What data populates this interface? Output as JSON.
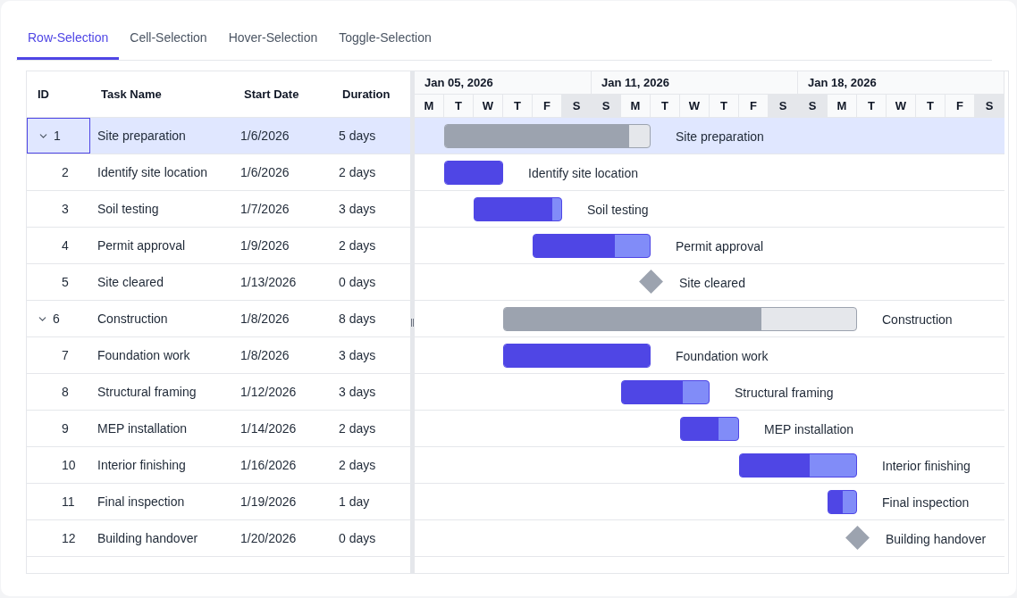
{
  "tabs": [
    {
      "label": "Row-Selection",
      "selected": true
    },
    {
      "label": "Cell-Selection",
      "selected": false
    },
    {
      "label": "Hover-Selection",
      "selected": false
    },
    {
      "label": "Toggle-Selection",
      "selected": false
    }
  ],
  "grid": {
    "columns": [
      "ID",
      "Task Name",
      "Start Date",
      "Duration"
    ]
  },
  "weeks": [
    {
      "label": "Jan 05, 2026",
      "days": [
        {
          "label": "M",
          "weekend": false
        },
        {
          "label": "T",
          "weekend": false
        },
        {
          "label": "W",
          "weekend": false
        },
        {
          "label": "T",
          "weekend": false
        },
        {
          "label": "F",
          "weekend": false
        },
        {
          "label": "S",
          "weekend": true
        }
      ]
    },
    {
      "label": "Jan 11, 2026",
      "days": [
        {
          "label": "S",
          "weekend": true
        },
        {
          "label": "M",
          "weekend": false
        },
        {
          "label": "T",
          "weekend": false
        },
        {
          "label": "W",
          "weekend": false
        },
        {
          "label": "T",
          "weekend": false
        },
        {
          "label": "F",
          "weekend": false
        },
        {
          "label": "S",
          "weekend": true
        }
      ]
    },
    {
      "label": "Jan 18, 2026",
      "days": [
        {
          "label": "S",
          "weekend": true
        },
        {
          "label": "M",
          "weekend": false
        },
        {
          "label": "T",
          "weekend": false
        },
        {
          "label": "W",
          "weekend": false
        },
        {
          "label": "T",
          "weekend": false
        },
        {
          "label": "F",
          "weekend": false
        },
        {
          "label": "S",
          "weekend": true
        }
      ]
    }
  ],
  "tasks": [
    {
      "id": "1",
      "name": "Site preparation",
      "start": "1/6/2026",
      "duration": "5 days",
      "bar_label": "Site preparation",
      "kind": "parent",
      "expanded": true,
      "selected": true,
      "level": 0.9,
      "children": [
        {
          "id": "2",
          "name": "Identify site location",
          "start": "1/6/2026",
          "duration": "2 days",
          "bar_label": "Identify site location",
          "kind": "task",
          "selected": false,
          "level": 1
        },
        {
          "id": "3",
          "name": "Soil testing",
          "start": "1/7/2026",
          "duration": "3 days",
          "bar_label": "Soil testing",
          "kind": "task",
          "selected": false,
          "level": 0.9
        },
        {
          "id": "4",
          "name": "Permit approval",
          "start": "1/9/2026",
          "duration": "2 days",
          "bar_label": "Permit approval",
          "kind": "task",
          "selected": false,
          "level": 0.7
        },
        {
          "id": "5",
          "name": "Site cleared",
          "start": "1/13/2026",
          "duration": "0 days",
          "bar_label": "Site cleared",
          "kind": "milestone",
          "selected": false
        }
      ]
    },
    {
      "id": "6",
      "name": "Construction",
      "start": "1/8/2026",
      "duration": "8 days",
      "bar_label": "Construction",
      "kind": "parent",
      "expanded": true,
      "selected": false,
      "level": 0.73,
      "children": [
        {
          "id": "7",
          "name": "Foundation work",
          "start": "1/8/2026",
          "duration": "3 days",
          "bar_label": "Foundation work",
          "kind": "task",
          "selected": false,
          "level": 1
        },
        {
          "id": "8",
          "name": "Structural framing",
          "start": "1/12/2026",
          "duration": "3 days",
          "bar_label": "Structural framing",
          "kind": "task",
          "selected": false,
          "level": 0.7
        },
        {
          "id": "9",
          "name": "MEP installation",
          "start": "1/14/2026",
          "duration": "2 days",
          "bar_label": "MEP installation",
          "kind": "task",
          "selected": false,
          "level": 0.65
        },
        {
          "id": "10",
          "name": "Interior finishing",
          "start": "1/16/2026",
          "duration": "2 days",
          "bar_label": "Interior finishing",
          "kind": "task",
          "selected": false,
          "level": 0.6
        },
        {
          "id": "11",
          "name": "Final inspection",
          "start": "1/19/2026",
          "duration": "1 day",
          "bar_label": "Final inspection",
          "kind": "task",
          "selected": false,
          "level": 0.5
        },
        {
          "id": "12",
          "name": "Building handover",
          "start": "1/20/2026",
          "duration": "0 days",
          "bar_label": "Building handover",
          "kind": "milestone",
          "selected": false
        }
      ]
    }
  ]
}
